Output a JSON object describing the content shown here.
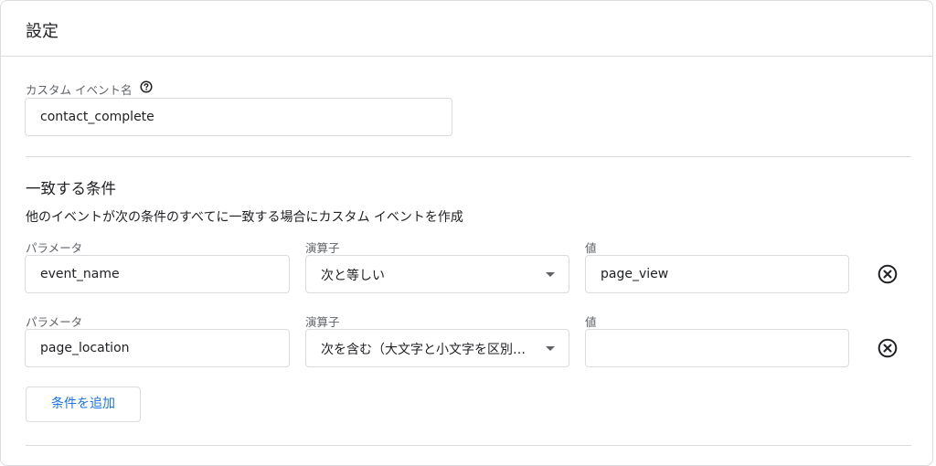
{
  "card": {
    "title": "設定"
  },
  "custom_event": {
    "label": "カスタム イベント名",
    "help_icon": "help-circle-icon",
    "value": "contact_complete"
  },
  "matching": {
    "title": "一致する条件",
    "description": "他のイベントが次の条件のすべてに一致する場合にカスタム イベントを作成",
    "conditions": [
      {
        "param_label": "パラメータ",
        "param_value": "event_name",
        "operator_label": "演算子",
        "operator_value": "次と等しい",
        "value_label": "値",
        "value": "page_view",
        "remove_icon": "close-circle-icon"
      },
      {
        "param_label": "パラメータ",
        "param_value": "page_location",
        "operator_label": "演算子",
        "operator_value": "次を含む（大文字と小文字を区別…",
        "value_label": "値",
        "value": "",
        "remove_icon": "close-circle-icon"
      }
    ],
    "add_button_label": "条件を追加"
  },
  "colors": {
    "accent": "#1a73e8",
    "border": "#dadce0",
    "muted_text": "#5f6368"
  }
}
